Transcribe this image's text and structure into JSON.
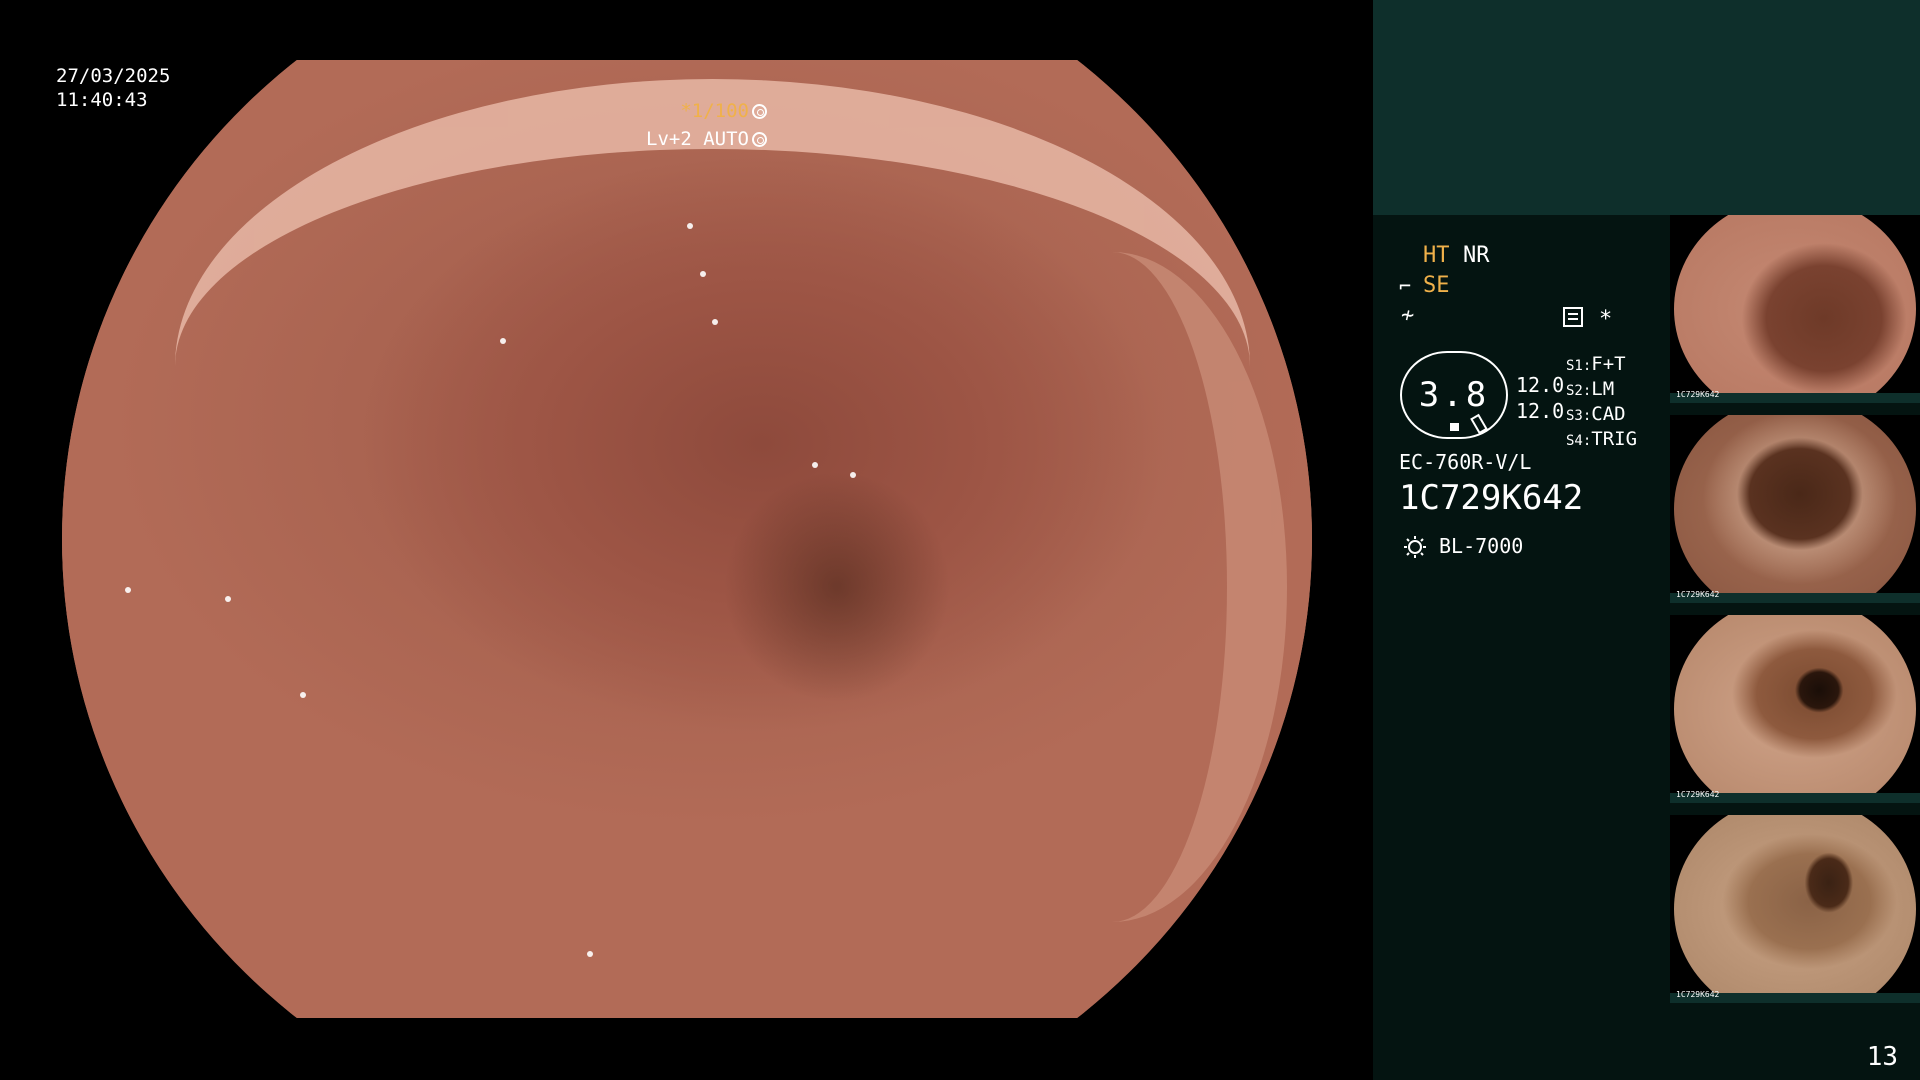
{
  "osd": {
    "date": "27/03/2025",
    "time": "11:40:43",
    "shutter": "*1/100",
    "level": "Lv+2 AUTO"
  },
  "panel": {
    "ht": "HT",
    "nr": "NR",
    "se": "SE",
    "star": "*",
    "gauge_value": "3.8",
    "gauge_left": "12.0",
    "gauge_right": "12.0",
    "switches": [
      {
        "key": "S1:",
        "value": "F+T"
      },
      {
        "key": "S2:",
        "value": "LM"
      },
      {
        "key": "S3:",
        "value": "CAD"
      },
      {
        "key": "S4:",
        "value": "TRIG"
      }
    ],
    "scope_model": "EC-760R-V/L",
    "serial": "1C729K642",
    "light_source": "BL-7000",
    "page_number": "13"
  },
  "thumbnails": [
    {
      "label": "1C729K642",
      "icon": "endoscopy-thumbnail"
    },
    {
      "label": "1C729K642",
      "icon": "endoscopy-thumbnail"
    },
    {
      "label": "1C729K642",
      "icon": "endoscopy-thumbnail"
    },
    {
      "label": "1C729K642",
      "icon": "endoscopy-thumbnail"
    }
  ],
  "colors": {
    "accent": "#f0b14a",
    "panel_bg": "#041411",
    "panel_header": "#0e2f2b"
  },
  "icons": [
    "iris-icon",
    "auto-exposure-icon",
    "structure-enhance-icon",
    "color-mode-icon",
    "menu-icon",
    "light-bulb-icon"
  ]
}
